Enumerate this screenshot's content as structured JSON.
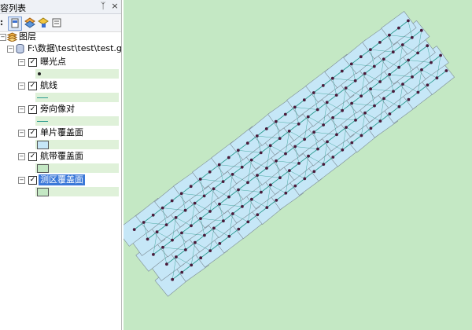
{
  "panel": {
    "title": "容列表",
    "pin_glyph": "ᛉ",
    "close_glyph": "×",
    "root_label": "图层",
    "gdb_label": "F:\\数据\\test\\test\\test.gdb",
    "layers": [
      {
        "name": "曝光点",
        "checked": true,
        "symbol": "point"
      },
      {
        "name": "航线",
        "checked": true,
        "symbol": "line"
      },
      {
        "name": "旁向像对",
        "checked": true,
        "symbol": "line"
      },
      {
        "name": "单片覆盖面",
        "checked": true,
        "symbol": "fill-blue"
      },
      {
        "name": "航带覆盖面",
        "checked": true,
        "symbol": "fill-green"
      },
      {
        "name": "测区覆盖面",
        "checked": true,
        "symbol": "fill-green",
        "selected": true
      }
    ]
  },
  "colors": {
    "map_bg": "#c4e8c4",
    "footprint_fill": "#c6e7f7",
    "footprint_stroke": "#7d8c95",
    "flight_line": "#2a9a8e",
    "exposure_point": "#4a1a3a"
  }
}
